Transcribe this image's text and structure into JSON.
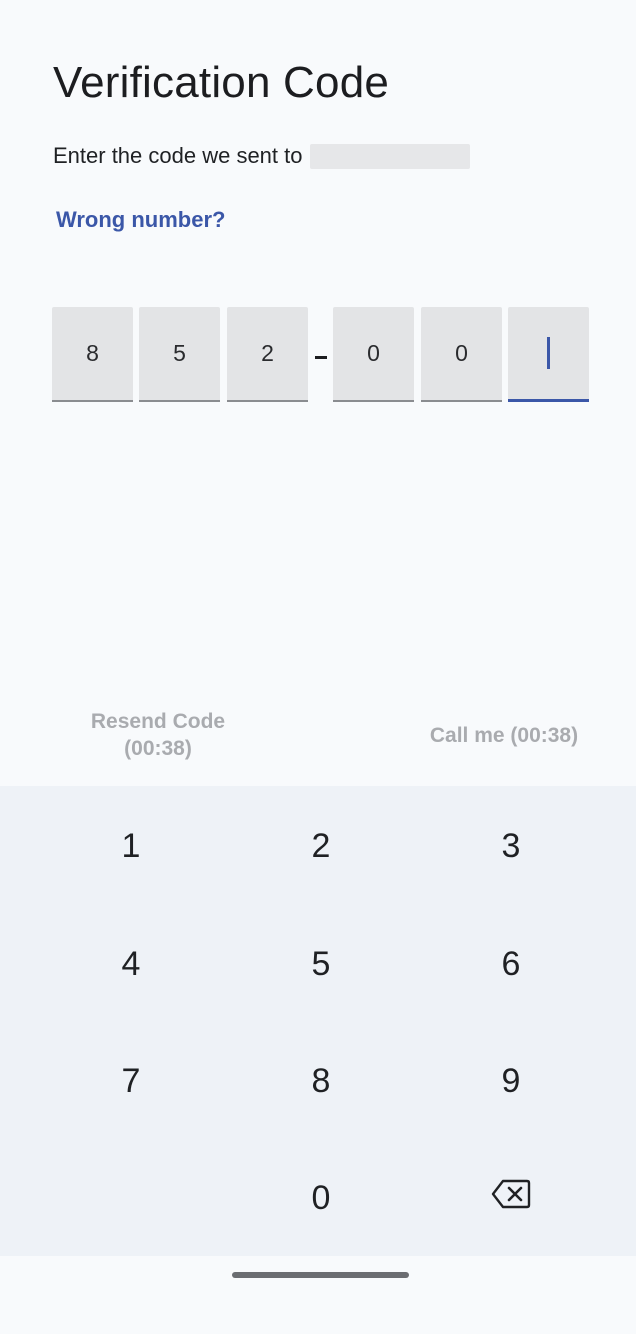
{
  "header": {
    "title": "Verification Code",
    "subtitle": "Enter the code we sent to",
    "wrong_number_link": "Wrong number?"
  },
  "code": {
    "digits": [
      "8",
      "5",
      "2",
      "0",
      "0",
      ""
    ],
    "separator": "-",
    "active_index": 5
  },
  "actions": {
    "resend_line1": "Resend Code",
    "resend_line2": "(00:38)",
    "call_me": "Call me (00:38)"
  },
  "keypad": {
    "keys": [
      "1",
      "2",
      "3",
      "4",
      "5",
      "6",
      "7",
      "8",
      "9",
      "",
      "0",
      "backspace"
    ],
    "backspace_icon": "backspace-icon"
  },
  "colors": {
    "accent": "#3b57a8",
    "disabled_text": "#a9abaf",
    "keypad_bg": "#eef2f7",
    "page_bg": "#f8fafc"
  }
}
